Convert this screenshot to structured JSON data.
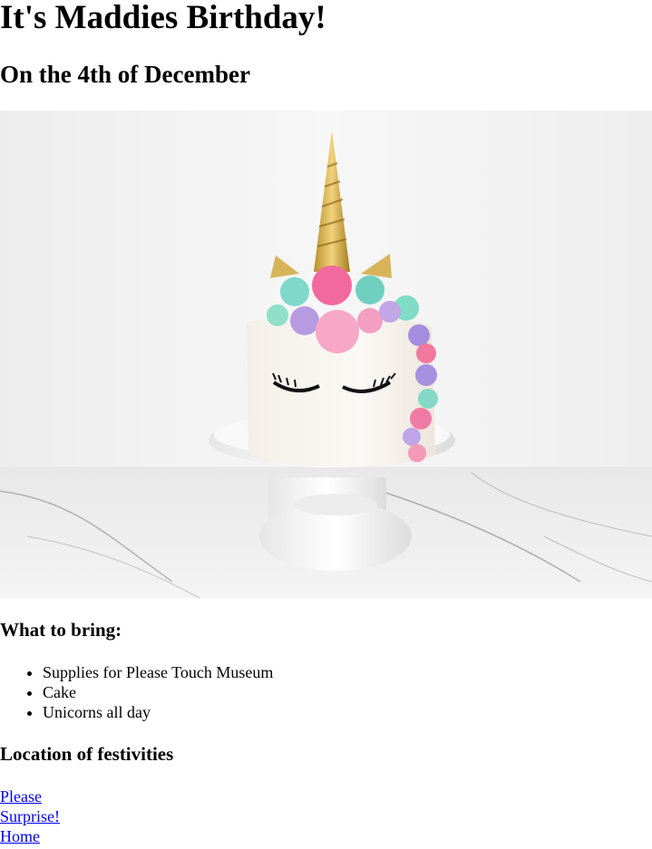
{
  "header": {
    "title": "It's Maddies Birthday!",
    "subtitle": "On the 4th of December"
  },
  "hero_image": {
    "alt": "unicorn cake",
    "icon": "unicorn-cake-photo"
  },
  "bring": {
    "heading": "What to bring:",
    "items": [
      "Supplies for Please Touch Museum",
      "Cake",
      "Unicorns all day"
    ]
  },
  "location": {
    "heading": "Location of festivities",
    "link_lines": [
      "Please",
      "Surprise!",
      "Home"
    ]
  },
  "colors": {
    "link": "#0000ee",
    "text": "#000000",
    "background": "#ffffff"
  }
}
